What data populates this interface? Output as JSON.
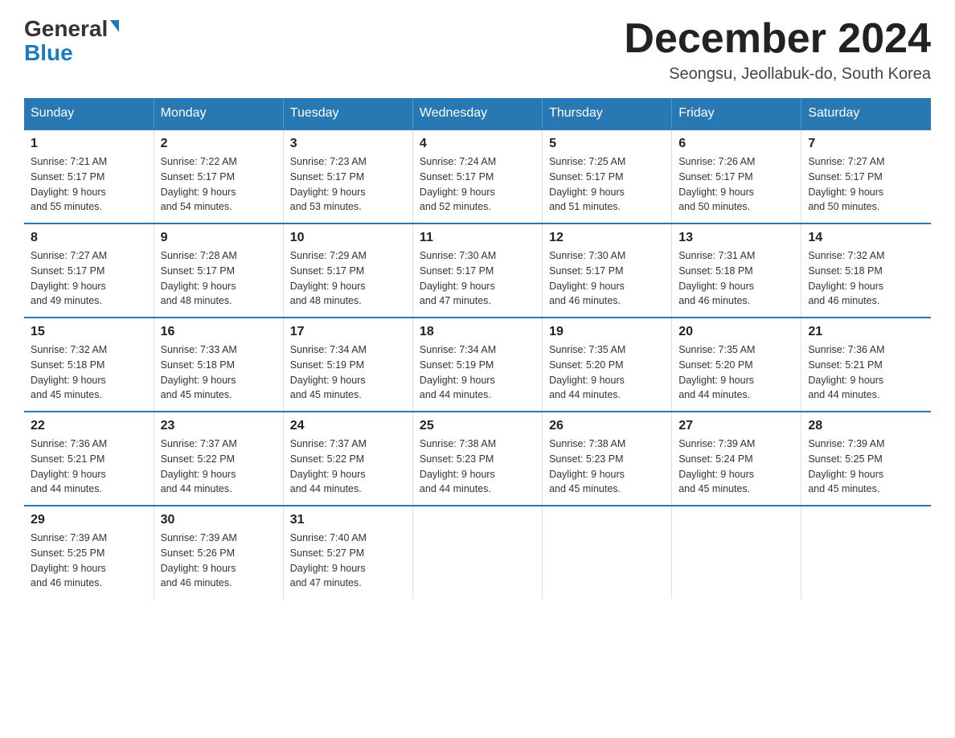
{
  "logo": {
    "general": "General",
    "blue": "Blue"
  },
  "title": "December 2024",
  "location": "Seongsu, Jeollabuk-do, South Korea",
  "days_of_week": [
    "Sunday",
    "Monday",
    "Tuesday",
    "Wednesday",
    "Thursday",
    "Friday",
    "Saturday"
  ],
  "weeks": [
    [
      {
        "day": "1",
        "sunrise": "7:21 AM",
        "sunset": "5:17 PM",
        "daylight": "9 hours and 55 minutes."
      },
      {
        "day": "2",
        "sunrise": "7:22 AM",
        "sunset": "5:17 PM",
        "daylight": "9 hours and 54 minutes."
      },
      {
        "day": "3",
        "sunrise": "7:23 AM",
        "sunset": "5:17 PM",
        "daylight": "9 hours and 53 minutes."
      },
      {
        "day": "4",
        "sunrise": "7:24 AM",
        "sunset": "5:17 PM",
        "daylight": "9 hours and 52 minutes."
      },
      {
        "day": "5",
        "sunrise": "7:25 AM",
        "sunset": "5:17 PM",
        "daylight": "9 hours and 51 minutes."
      },
      {
        "day": "6",
        "sunrise": "7:26 AM",
        "sunset": "5:17 PM",
        "daylight": "9 hours and 50 minutes."
      },
      {
        "day": "7",
        "sunrise": "7:27 AM",
        "sunset": "5:17 PM",
        "daylight": "9 hours and 50 minutes."
      }
    ],
    [
      {
        "day": "8",
        "sunrise": "7:27 AM",
        "sunset": "5:17 PM",
        "daylight": "9 hours and 49 minutes."
      },
      {
        "day": "9",
        "sunrise": "7:28 AM",
        "sunset": "5:17 PM",
        "daylight": "9 hours and 48 minutes."
      },
      {
        "day": "10",
        "sunrise": "7:29 AM",
        "sunset": "5:17 PM",
        "daylight": "9 hours and 48 minutes."
      },
      {
        "day": "11",
        "sunrise": "7:30 AM",
        "sunset": "5:17 PM",
        "daylight": "9 hours and 47 minutes."
      },
      {
        "day": "12",
        "sunrise": "7:30 AM",
        "sunset": "5:17 PM",
        "daylight": "9 hours and 46 minutes."
      },
      {
        "day": "13",
        "sunrise": "7:31 AM",
        "sunset": "5:18 PM",
        "daylight": "9 hours and 46 minutes."
      },
      {
        "day": "14",
        "sunrise": "7:32 AM",
        "sunset": "5:18 PM",
        "daylight": "9 hours and 46 minutes."
      }
    ],
    [
      {
        "day": "15",
        "sunrise": "7:32 AM",
        "sunset": "5:18 PM",
        "daylight": "9 hours and 45 minutes."
      },
      {
        "day": "16",
        "sunrise": "7:33 AM",
        "sunset": "5:18 PM",
        "daylight": "9 hours and 45 minutes."
      },
      {
        "day": "17",
        "sunrise": "7:34 AM",
        "sunset": "5:19 PM",
        "daylight": "9 hours and 45 minutes."
      },
      {
        "day": "18",
        "sunrise": "7:34 AM",
        "sunset": "5:19 PM",
        "daylight": "9 hours and 44 minutes."
      },
      {
        "day": "19",
        "sunrise": "7:35 AM",
        "sunset": "5:20 PM",
        "daylight": "9 hours and 44 minutes."
      },
      {
        "day": "20",
        "sunrise": "7:35 AM",
        "sunset": "5:20 PM",
        "daylight": "9 hours and 44 minutes."
      },
      {
        "day": "21",
        "sunrise": "7:36 AM",
        "sunset": "5:21 PM",
        "daylight": "9 hours and 44 minutes."
      }
    ],
    [
      {
        "day": "22",
        "sunrise": "7:36 AM",
        "sunset": "5:21 PM",
        "daylight": "9 hours and 44 minutes."
      },
      {
        "day": "23",
        "sunrise": "7:37 AM",
        "sunset": "5:22 PM",
        "daylight": "9 hours and 44 minutes."
      },
      {
        "day": "24",
        "sunrise": "7:37 AM",
        "sunset": "5:22 PM",
        "daylight": "9 hours and 44 minutes."
      },
      {
        "day": "25",
        "sunrise": "7:38 AM",
        "sunset": "5:23 PM",
        "daylight": "9 hours and 44 minutes."
      },
      {
        "day": "26",
        "sunrise": "7:38 AM",
        "sunset": "5:23 PM",
        "daylight": "9 hours and 45 minutes."
      },
      {
        "day": "27",
        "sunrise": "7:39 AM",
        "sunset": "5:24 PM",
        "daylight": "9 hours and 45 minutes."
      },
      {
        "day": "28",
        "sunrise": "7:39 AM",
        "sunset": "5:25 PM",
        "daylight": "9 hours and 45 minutes."
      }
    ],
    [
      {
        "day": "29",
        "sunrise": "7:39 AM",
        "sunset": "5:25 PM",
        "daylight": "9 hours and 46 minutes."
      },
      {
        "day": "30",
        "sunrise": "7:39 AM",
        "sunset": "5:26 PM",
        "daylight": "9 hours and 46 minutes."
      },
      {
        "day": "31",
        "sunrise": "7:40 AM",
        "sunset": "5:27 PM",
        "daylight": "9 hours and 47 minutes."
      },
      null,
      null,
      null,
      null
    ]
  ],
  "labels": {
    "sunrise": "Sunrise:",
    "sunset": "Sunset:",
    "daylight": "Daylight:"
  }
}
